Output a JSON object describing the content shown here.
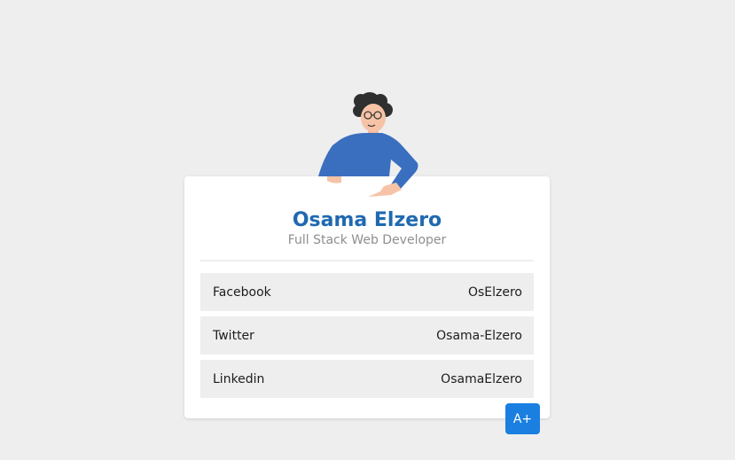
{
  "profile": {
    "name": "Osama Elzero",
    "title": "Full Stack Web Developer"
  },
  "links": [
    {
      "network": "Facebook",
      "handle": "OsElzero"
    },
    {
      "network": "Twitter",
      "handle": "Osama-Elzero"
    },
    {
      "network": "Linkedin",
      "handle": "OsamaElzero"
    }
  ],
  "fab": {
    "label": "A+"
  },
  "colors": {
    "background": "#eeeeee",
    "accent": "#1f69b0",
    "fab": "#1a7fe0",
    "shirt": "#3a6fbf"
  },
  "icons": {
    "avatar": "developer-avatar-illustration"
  }
}
